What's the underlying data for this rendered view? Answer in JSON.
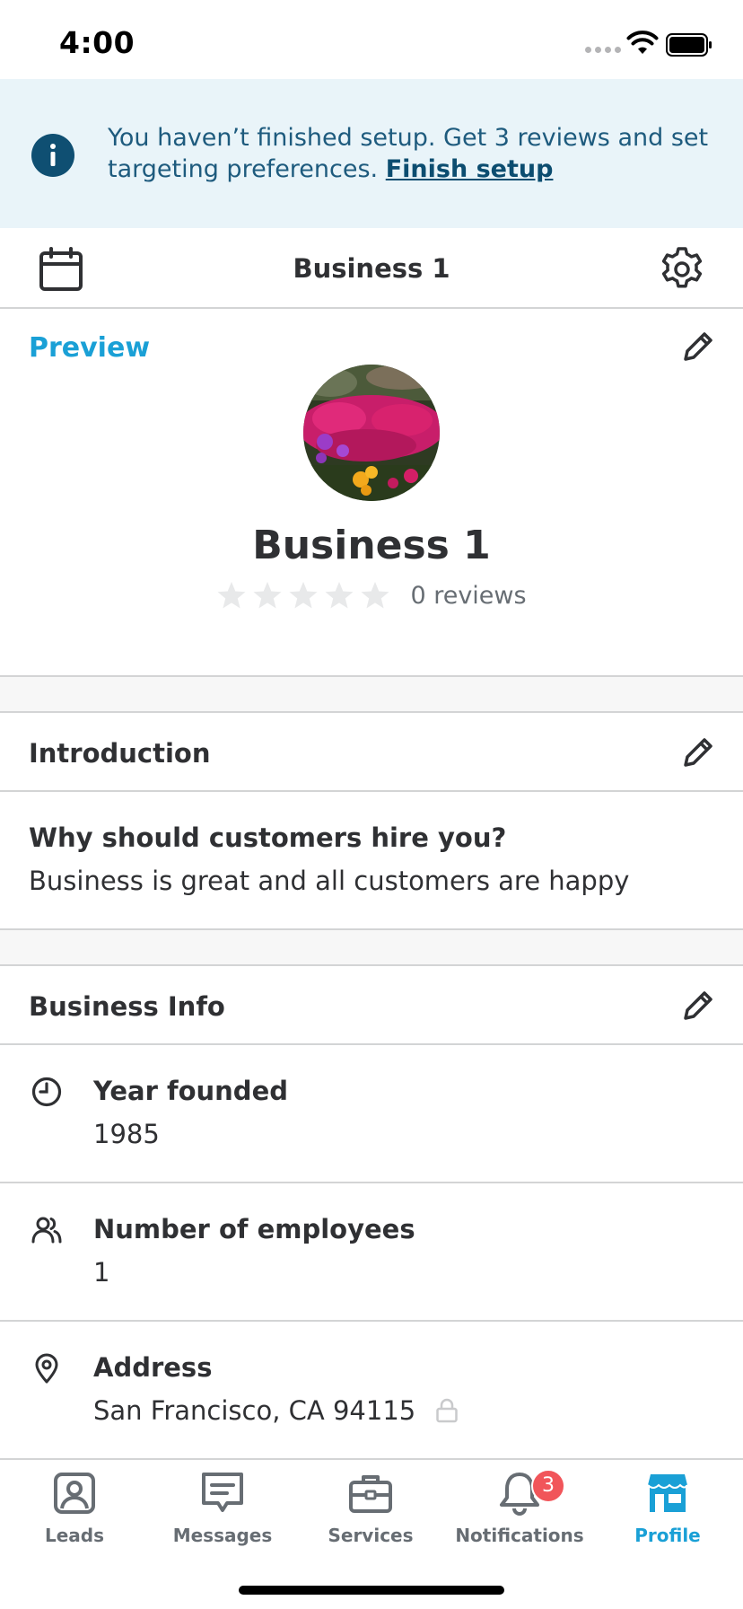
{
  "status_bar": {
    "time": "4:00"
  },
  "banner": {
    "message": "You haven’t finished setup. Get 3 reviews and set targeting preferences. ",
    "link_label": "Finish setup"
  },
  "top_nav": {
    "title": "Business 1"
  },
  "preview": {
    "label": "Preview",
    "business_name": "Business 1",
    "rating_stars": 0,
    "reviews_text": "0 reviews"
  },
  "introduction": {
    "title": "Introduction",
    "question": "Why should customers hire you?",
    "answer": "Business is great and all customers are happy"
  },
  "business_info": {
    "title": "Business Info",
    "rows": [
      {
        "icon": "clock-icon",
        "label": "Year founded",
        "value": "1985"
      },
      {
        "icon": "people-icon",
        "label": "Number of employees",
        "value": "1"
      },
      {
        "icon": "location-pin-icon",
        "label": "Address",
        "value": "San Francisco, CA 94115"
      }
    ]
  },
  "tab_bar": {
    "tabs": [
      {
        "label": "Leads",
        "icon": "leads-icon"
      },
      {
        "label": "Messages",
        "icon": "messages-icon"
      },
      {
        "label": "Services",
        "icon": "briefcase-icon"
      },
      {
        "label": "Notifications",
        "icon": "bell-icon",
        "badge": "3"
      },
      {
        "label": "Profile",
        "icon": "storefront-icon",
        "active": true
      }
    ]
  },
  "colors": {
    "accent": "#1aa0d6",
    "banner_bg": "#e9f4f9",
    "banner_text": "#1e5b7e",
    "badge": "#f1555a"
  }
}
